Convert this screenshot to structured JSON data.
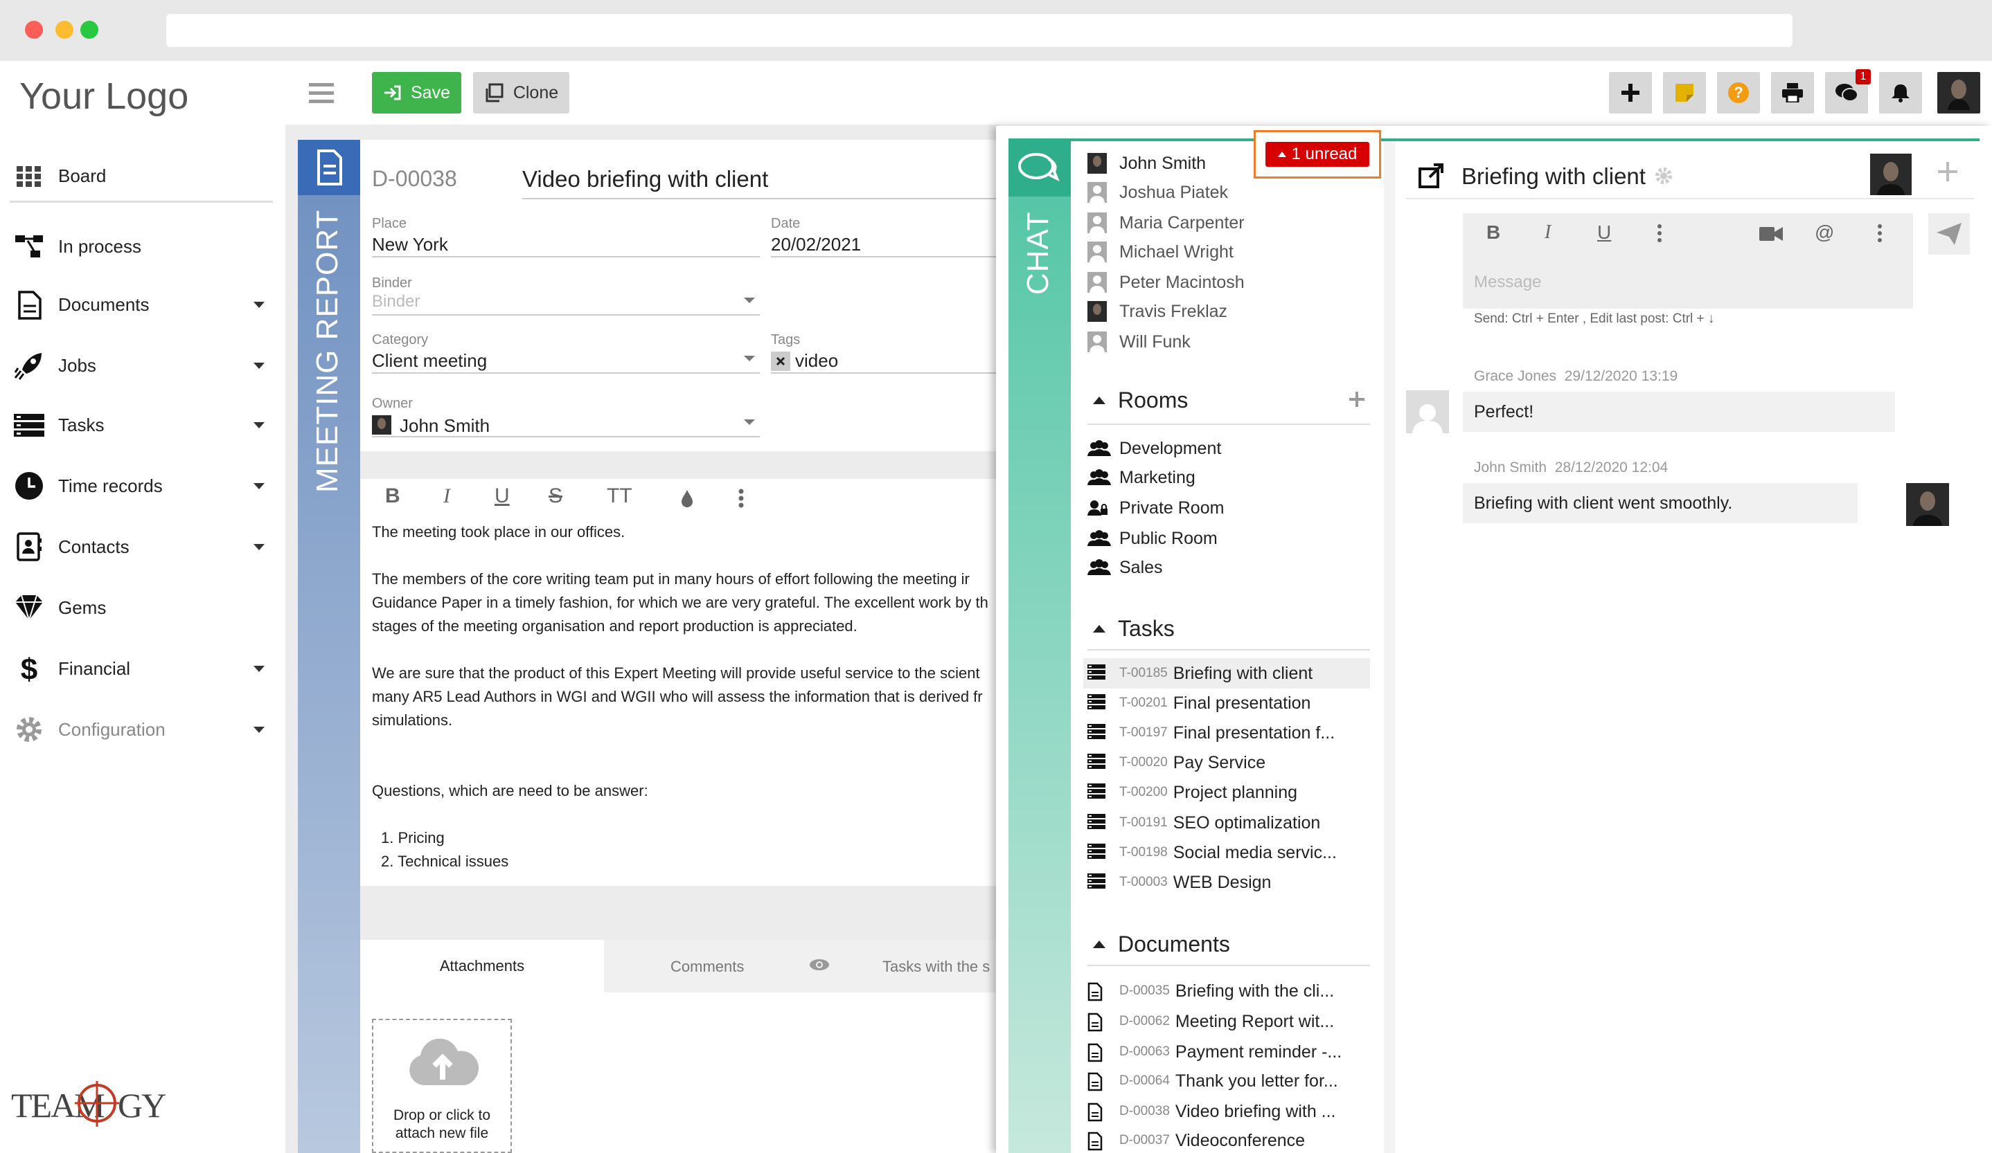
{
  "window": {
    "url": ""
  },
  "logo": {
    "text": "Your Logo"
  },
  "brand": {
    "footer_logo": "TEAMOGY"
  },
  "nav": {
    "items": [
      {
        "label": "Board",
        "icon": "grid-icon"
      },
      {
        "label": "In process",
        "icon": "flow-icon"
      },
      {
        "label": "Documents",
        "icon": "document-icon"
      },
      {
        "label": "Jobs",
        "icon": "rocket-icon"
      },
      {
        "label": "Tasks",
        "icon": "tasks-icon"
      },
      {
        "label": "Time records",
        "icon": "clock-icon"
      },
      {
        "label": "Contacts",
        "icon": "contact-icon"
      },
      {
        "label": "Gems",
        "icon": "diamond-icon"
      },
      {
        "label": "Financial",
        "icon": "dollar-icon"
      },
      {
        "label": "Configuration",
        "icon": "gear-icon"
      }
    ]
  },
  "toolbar": {
    "save_label": "Save",
    "clone_label": "Clone",
    "chat_badge": "1",
    "icons": [
      "plus-icon",
      "note-icon",
      "help-icon",
      "print-icon",
      "chat-icon",
      "bell-icon",
      "user-avatar"
    ]
  },
  "document": {
    "side_label": "MEETING REPORT",
    "id": "D-00038",
    "title": "Video briefing with client",
    "place_label": "Place",
    "place_value": "New York",
    "date_label": "Date",
    "date_value": "20/02/2021",
    "binder_label": "Binder",
    "binder_placeholder": "Binder",
    "category_label": "Category",
    "category_value": "Client meeting",
    "tags_label": "Tags",
    "tags_value": "video",
    "owner_label": "Owner",
    "owner_value": "John Smith",
    "editor_tools": [
      "B",
      "I",
      "U",
      "S",
      "TT",
      "ink",
      "more"
    ],
    "body": [
      "The meeting took place in our offices.",
      "The members of the core writing team put in many hours of effort following the meeting ir",
      "Guidance Paper in a timely fashion, for which we are very grateful. The excellent work by th",
      "stages of the meeting organisation and report production is appreciated.",
      "We are sure that the product of this Expert Meeting will provide useful service to the scient",
      "many AR5 Lead Authors in WGI and WGII who will assess the information that is derived fr",
      "simulations.",
      "Questions, which are need to be answer:",
      "1.  Pricing",
      "2. Technical issues"
    ],
    "tabs": {
      "attachments": "Attachments",
      "comments": "Comments",
      "tasks": "Tasks with the s"
    },
    "dropzone_line1": "Drop or click to",
    "dropzone_line2": "attach new file"
  },
  "chat": {
    "side_label": "CHAT",
    "unread_label": "1 unread",
    "people": [
      {
        "name": "John Smith",
        "avatar": "photo"
      },
      {
        "name": "Joshua Piatek",
        "avatar": "default"
      },
      {
        "name": "Maria Carpenter",
        "avatar": "default"
      },
      {
        "name": "Michael Wright",
        "avatar": "default"
      },
      {
        "name": "Peter Macintosh",
        "avatar": "default"
      },
      {
        "name": "Travis Freklaz",
        "avatar": "photo"
      },
      {
        "name": "Will Funk",
        "avatar": "default"
      }
    ],
    "rooms_title": "Rooms",
    "rooms": [
      {
        "name": "Development",
        "icon": "group-icon"
      },
      {
        "name": "Marketing",
        "icon": "group-icon"
      },
      {
        "name": "Private Room",
        "icon": "private-group-icon"
      },
      {
        "name": "Public Room",
        "icon": "group-icon"
      },
      {
        "name": "Sales",
        "icon": "group-icon"
      }
    ],
    "tasks_title": "Tasks",
    "tasks": [
      {
        "id": "T-00185",
        "name": "Briefing with client"
      },
      {
        "id": "T-00201",
        "name": "Final presentation"
      },
      {
        "id": "T-00197",
        "name": "Final presentation f..."
      },
      {
        "id": "T-00020",
        "name": "Pay Service"
      },
      {
        "id": "T-00200",
        "name": "Project planning"
      },
      {
        "id": "T-00191",
        "name": "SEO optimalization"
      },
      {
        "id": "T-00198",
        "name": "Social media servic..."
      },
      {
        "id": "T-00003",
        "name": "WEB Design"
      }
    ],
    "documents_title": "Documents",
    "documents": [
      {
        "id": "D-00035",
        "name": "Briefing with the cli..."
      },
      {
        "id": "D-00062",
        "name": "Meeting Report wit..."
      },
      {
        "id": "D-00063",
        "name": "Payment reminder -..."
      },
      {
        "id": "D-00064",
        "name": "Thank you letter for..."
      },
      {
        "id": "D-00038",
        "name": "Video briefing with ..."
      },
      {
        "id": "D-00037",
        "name": "Videoconference"
      }
    ],
    "conversation": {
      "title": "Briefing with client",
      "message_placeholder": "Message",
      "hint": "Send: Ctrl + Enter , Edit last post: Ctrl + ↓",
      "messages": [
        {
          "author": "Grace Jones",
          "time": "29/12/2020 13:19",
          "text": "Perfect!"
        },
        {
          "author": "John Smith",
          "time": "28/12/2020 12:04",
          "text": "Briefing with client went smoothly."
        }
      ]
    }
  },
  "colors": {
    "save": "#3fb44c",
    "doc_accent": "#3a6bb6",
    "chat_accent": "#2fae8b",
    "unread": "#d70000",
    "highlight": "#f07c2a"
  }
}
